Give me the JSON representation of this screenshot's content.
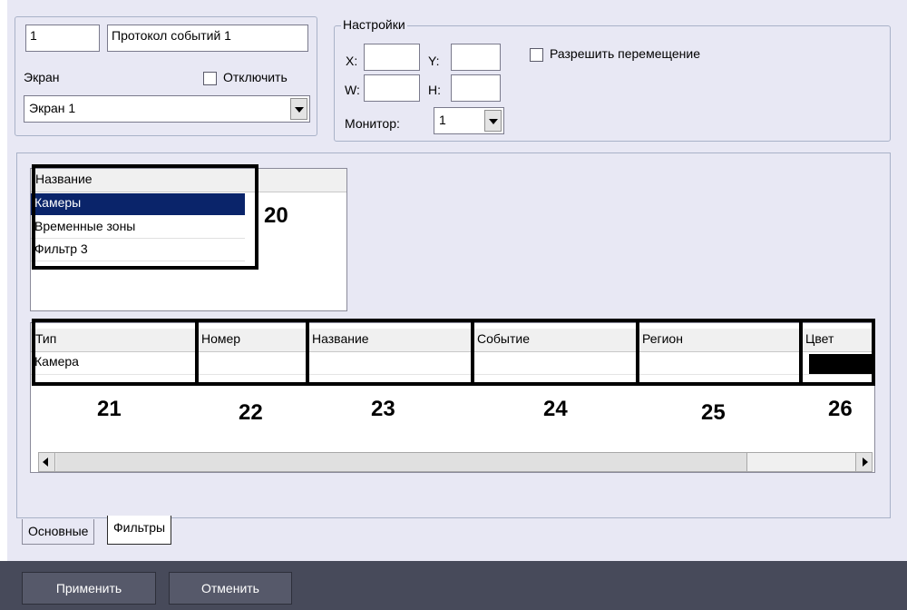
{
  "object": {
    "id_value": "1",
    "name_value": "Протокол событий 1",
    "screen_label": "Экран",
    "disable_label": "Отключить",
    "screen_value": "Экран 1"
  },
  "settings": {
    "title": "Настройки",
    "x_label": "X:",
    "y_label": "Y:",
    "w_label": "W:",
    "h_label": "H:",
    "x_value": "",
    "y_value": "",
    "w_value": "",
    "h_value": "",
    "allow_move_label": "Разрешить перемещение",
    "monitor_label": "Монитор:",
    "monitor_value": "1"
  },
  "filters_table": {
    "header": "Название",
    "rows": [
      "Камеры",
      "Временные зоны",
      "Фильтр 3"
    ],
    "selected_index": 0
  },
  "details_table": {
    "columns": [
      "Тип",
      "Номер",
      "Название",
      "Событие",
      "Регион",
      "Цвет"
    ],
    "row": {
      "type": "Камера",
      "number": "",
      "name": "",
      "event": "",
      "region": "",
      "color": "#000000"
    }
  },
  "callouts": [
    "20",
    "21",
    "22",
    "23",
    "24",
    "25",
    "26"
  ],
  "tabs": [
    "Основные",
    "Фильтры"
  ],
  "active_tab": "Фильтры",
  "buttons": {
    "apply": "Применить",
    "cancel": "Отменить"
  },
  "colors": {
    "window_bg": "#e8e8f4",
    "selection": "#0a246a",
    "button_bg": "#56596a",
    "bottom_bar": "#474a5a"
  }
}
